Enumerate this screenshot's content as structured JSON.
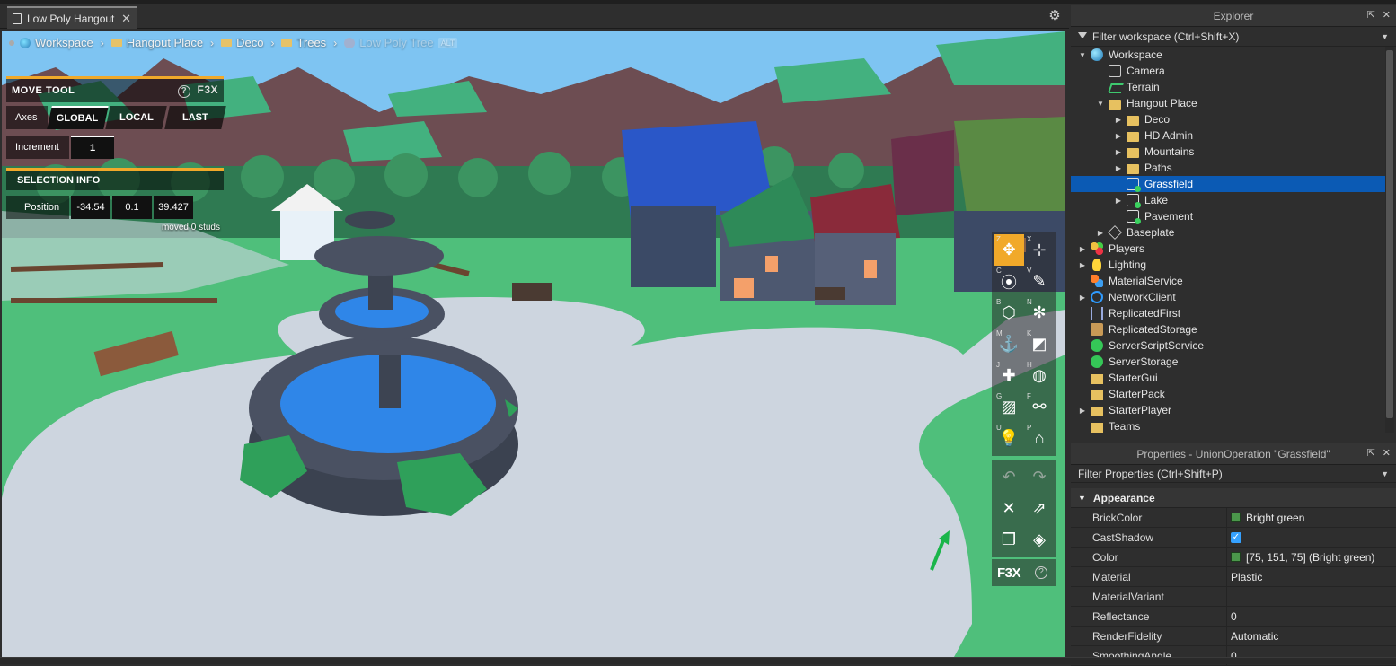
{
  "document_tab": {
    "title": "Low Poly Hangout",
    "close": "✕"
  },
  "breadcrumb": [
    {
      "label": "Workspace",
      "icon": "globe-icon"
    },
    {
      "label": "Hangout Place",
      "icon": "folder-icon"
    },
    {
      "label": "Deco",
      "icon": "folder-icon"
    },
    {
      "label": "Trees",
      "icon": "folder-icon"
    },
    {
      "label": "Low Poly Tree",
      "icon": "union-icon",
      "badge": "ALT"
    }
  ],
  "move_tool": {
    "title": "MOVE TOOL",
    "help": "?",
    "logo": "F3X",
    "axes_label": "Axes",
    "axes_options": [
      "GLOBAL",
      "LOCAL",
      "LAST"
    ],
    "axes_selected": "GLOBAL",
    "increment_label": "Increment",
    "increment_value": "1",
    "selection_title": "SELECTION INFO",
    "position_label": "Position",
    "position_values": [
      "-34.54",
      "0.1",
      "39.427"
    ],
    "moved_note": "moved 0 studs"
  },
  "toolbar": {
    "buttons": [
      {
        "key": "Z",
        "icon": "move-icon",
        "glyph": "✥",
        "active": true
      },
      {
        "key": "X",
        "icon": "resize-icon",
        "glyph": "⊹"
      },
      {
        "key": "C",
        "icon": "rotate-icon",
        "glyph": "⦿"
      },
      {
        "key": "V",
        "icon": "paint-icon",
        "glyph": "✎"
      },
      {
        "key": "B",
        "icon": "surface-icon",
        "glyph": "⬡"
      },
      {
        "key": "N",
        "icon": "material-icon",
        "glyph": "✻"
      },
      {
        "key": "M",
        "icon": "anchor-icon",
        "glyph": "⚓"
      },
      {
        "key": "K",
        "icon": "collision-icon",
        "glyph": "◩"
      },
      {
        "key": "J",
        "icon": "new-part-icon",
        "glyph": "✚"
      },
      {
        "key": "H",
        "icon": "mesh-icon",
        "glyph": "◍"
      },
      {
        "key": "G",
        "icon": "texture-icon",
        "glyph": "▨"
      },
      {
        "key": "F",
        "icon": "weld-icon",
        "glyph": "⚯"
      },
      {
        "key": "U",
        "icon": "lighting-icon",
        "glyph": "💡"
      },
      {
        "key": "P",
        "icon": "decorate-icon",
        "glyph": "⌂"
      }
    ],
    "actions": [
      {
        "icon": "undo-icon",
        "glyph": "↶"
      },
      {
        "icon": "redo-icon",
        "glyph": "↷"
      },
      {
        "icon": "delete-icon",
        "glyph": "✕"
      },
      {
        "icon": "export-icon",
        "glyph": "⇗"
      },
      {
        "icon": "clone-icon",
        "glyph": "❐"
      },
      {
        "icon": "group-icon",
        "glyph": "◈"
      }
    ],
    "logo": "F3X",
    "help": "?"
  },
  "explorer": {
    "title": "Explorer",
    "filter_placeholder": "Filter workspace (Ctrl+Shift+X)",
    "items": [
      {
        "label": "Workspace",
        "depth": 0,
        "arrow": "▼",
        "icon": "i-globe",
        "name": "workspace"
      },
      {
        "label": "Camera",
        "depth": 1,
        "arrow": "",
        "icon": "i-camera",
        "name": "camera"
      },
      {
        "label": "Terrain",
        "depth": 1,
        "arrow": "",
        "icon": "i-terrain",
        "name": "terrain"
      },
      {
        "label": "Hangout Place",
        "depth": 1,
        "arrow": "▼",
        "icon": "i-folder",
        "name": "hangout-place"
      },
      {
        "label": "Deco",
        "depth": 2,
        "arrow": "▶",
        "icon": "i-folder",
        "name": "deco"
      },
      {
        "label": "HD Admin",
        "depth": 2,
        "arrow": "▶",
        "icon": "i-folder",
        "name": "hd-admin"
      },
      {
        "label": "Mountains",
        "depth": 2,
        "arrow": "▶",
        "icon": "i-folder",
        "name": "mountains"
      },
      {
        "label": "Paths",
        "depth": 2,
        "arrow": "▶",
        "icon": "i-folder",
        "name": "paths"
      },
      {
        "label": "Grassfield",
        "depth": 2,
        "arrow": "",
        "icon": "i-union",
        "name": "grassfield",
        "selected": true
      },
      {
        "label": "Lake",
        "depth": 2,
        "arrow": "▶",
        "icon": "i-union",
        "name": "lake"
      },
      {
        "label": "Pavement",
        "depth": 2,
        "arrow": "",
        "icon": "i-union",
        "name": "pavement"
      },
      {
        "label": "Baseplate",
        "depth": 1,
        "arrow": "▶",
        "icon": "i-cube",
        "name": "baseplate"
      },
      {
        "label": "Players",
        "depth": 0,
        "arrow": "▶",
        "icon": "i-players",
        "name": "players"
      },
      {
        "label": "Lighting",
        "depth": 0,
        "arrow": "▶",
        "icon": "i-bulb",
        "name": "lighting"
      },
      {
        "label": "MaterialService",
        "depth": 0,
        "arrow": "",
        "icon": "i-material",
        "name": "material-service"
      },
      {
        "label": "NetworkClient",
        "depth": 0,
        "arrow": "▶",
        "icon": "i-network",
        "name": "network-client"
      },
      {
        "label": "ReplicatedFirst",
        "depth": 0,
        "arrow": "",
        "icon": "i-repl",
        "name": "replicated-first"
      },
      {
        "label": "ReplicatedStorage",
        "depth": 0,
        "arrow": "",
        "icon": "i-box",
        "name": "replicated-storage"
      },
      {
        "label": "ServerScriptService",
        "depth": 0,
        "arrow": "",
        "icon": "i-green",
        "name": "server-script-service"
      },
      {
        "label": "ServerStorage",
        "depth": 0,
        "arrow": "",
        "icon": "i-green",
        "name": "server-storage"
      },
      {
        "label": "StarterGui",
        "depth": 0,
        "arrow": "",
        "icon": "i-gui",
        "name": "starter-gui"
      },
      {
        "label": "StarterPack",
        "depth": 0,
        "arrow": "",
        "icon": "i-pack",
        "name": "starter-pack"
      },
      {
        "label": "StarterPlayer",
        "depth": 0,
        "arrow": "▶",
        "icon": "i-pack",
        "name": "starter-player"
      },
      {
        "label": "Teams",
        "depth": 0,
        "arrow": "",
        "icon": "i-pack",
        "name": "teams"
      }
    ]
  },
  "properties": {
    "title": "Properties - UnionOperation \"Grassfield\"",
    "filter_placeholder": "Filter Properties (Ctrl+Shift+P)",
    "category": "Appearance",
    "rows": [
      {
        "name": "BrickColor",
        "value": "Bright green",
        "swatch": "#4b974b"
      },
      {
        "name": "CastShadow",
        "value": "",
        "checkbox": true
      },
      {
        "name": "Color",
        "value": "[75, 151, 75] (Bright green)",
        "swatch": "#4b974b"
      },
      {
        "name": "Material",
        "value": "Plastic"
      },
      {
        "name": "MaterialVariant",
        "value": ""
      },
      {
        "name": "Reflectance",
        "value": "0"
      },
      {
        "name": "RenderFidelity",
        "value": "Automatic"
      },
      {
        "name": "SmoothingAngle",
        "value": "0"
      }
    ]
  },
  "colors": {
    "accent": "#f1a92a",
    "selection": "#0b5ab4",
    "grass": "#4fbf7b",
    "pavement": "#c9d2dc",
    "water": "#2f86e8"
  }
}
